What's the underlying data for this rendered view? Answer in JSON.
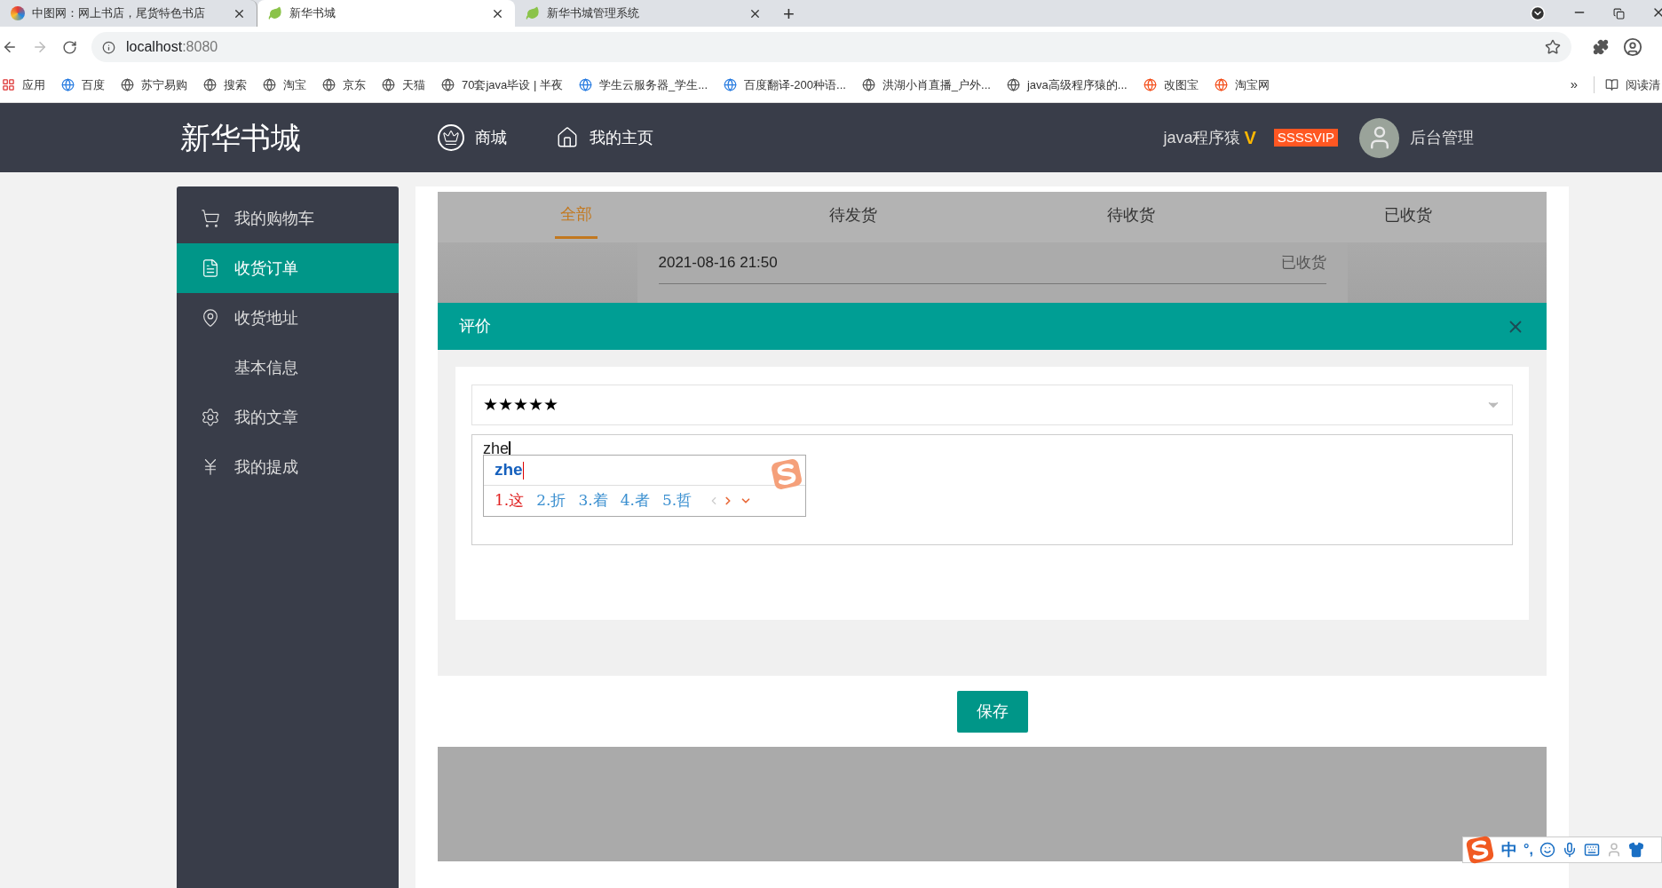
{
  "browser": {
    "tabs": [
      {
        "title": "中图网：网上书店，尾货特色书店",
        "selected": false
      },
      {
        "title": "新华书城",
        "selected": true
      },
      {
        "title": "新华书城管理系统",
        "selected": false
      }
    ],
    "new_tab": "+",
    "address": {
      "host": "localhost",
      "port": ":8080"
    },
    "bookmarks": [
      {
        "label": "应用"
      },
      {
        "label": "百度"
      },
      {
        "label": "苏宁易购"
      },
      {
        "label": "搜索"
      },
      {
        "label": "淘宝"
      },
      {
        "label": "京东"
      },
      {
        "label": "天猫"
      },
      {
        "label": "70套java毕设 | 半夜"
      },
      {
        "label": "学生云服务器_学生..."
      },
      {
        "label": "百度翻译-200种语..."
      },
      {
        "label": "洪湖小肖直播_户外..."
      },
      {
        "label": "java高级程序猿的..."
      },
      {
        "label": "改图宝"
      },
      {
        "label": "淘宝网"
      }
    ],
    "bookmarks_overflow": "»",
    "reading_list": "阅读清"
  },
  "header": {
    "logo": "新华书城",
    "nav": [
      {
        "label": "商城"
      },
      {
        "label": "我的主页"
      }
    ],
    "username": "java程序猿",
    "verified_mark": "V",
    "vip_badge": "SSSSVIP",
    "admin_link": "后台管理"
  },
  "sidebar": {
    "items": [
      {
        "label": "我的购物车",
        "selected": false
      },
      {
        "label": "收货订单",
        "selected": true
      },
      {
        "label": "收货地址",
        "selected": false
      },
      {
        "label": "基本信息",
        "selected": false
      },
      {
        "label": "我的文章",
        "selected": false
      },
      {
        "label": "我的提成",
        "selected": false
      }
    ]
  },
  "order_tabs": [
    {
      "label": "全部",
      "selected": true
    },
    {
      "label": "待发货",
      "selected": false
    },
    {
      "label": "待收货",
      "selected": false
    },
    {
      "label": "已收货",
      "selected": false
    }
  ],
  "order": {
    "time": "2021-08-16 21:50",
    "status": "已收货"
  },
  "dialog": {
    "title": "评价",
    "rating_select": {
      "value": "★★★★★"
    },
    "comment": {
      "value": "zhe"
    },
    "save_button": "保存"
  },
  "ime": {
    "composition": "zhe",
    "candidates": [
      {
        "label": "1.这",
        "selected": true
      },
      {
        "label": "2.折",
        "selected": false
      },
      {
        "label": "3.着",
        "selected": false
      },
      {
        "label": "4.者",
        "selected": false
      },
      {
        "label": "5.哲",
        "selected": false
      }
    ],
    "toolbar": {
      "mode": "中",
      "punctuation": "°,"
    }
  }
}
